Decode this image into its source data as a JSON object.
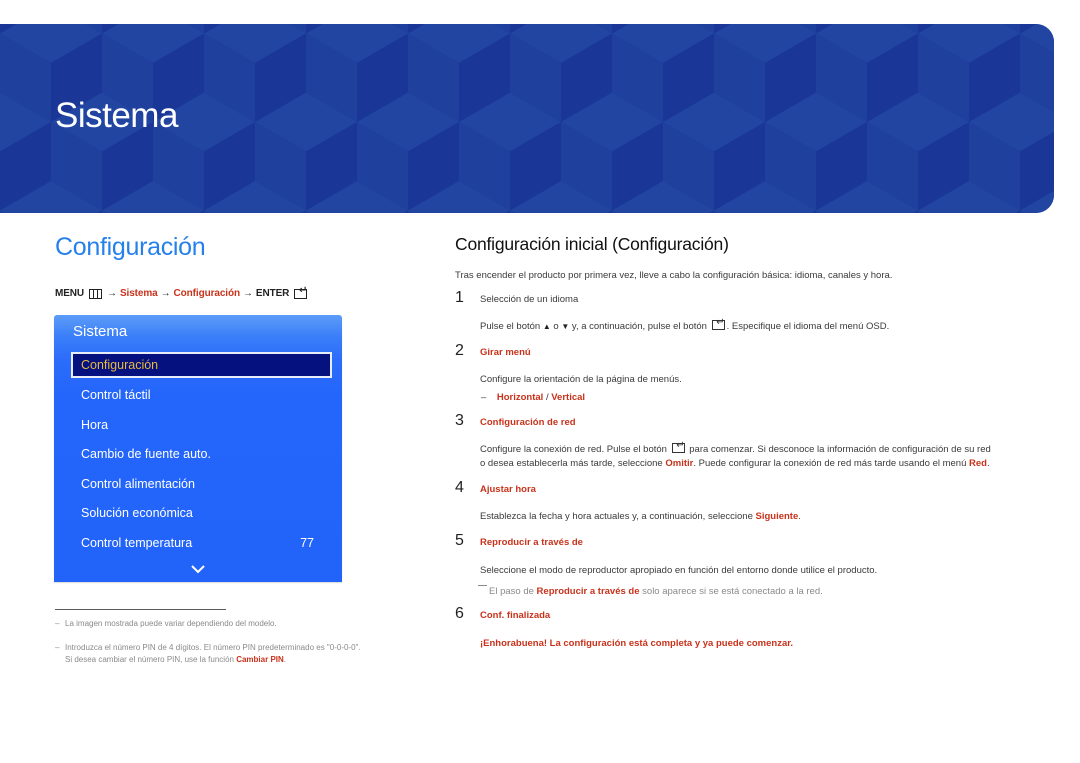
{
  "banner": {
    "title": "Sistema"
  },
  "section": {
    "title": "Configuración",
    "breadcrumb": {
      "menu": "MENU",
      "menu_icon": "menu-grid-icon",
      "arrow": "→",
      "path": [
        "Sistema",
        "Configuración"
      ],
      "enter": "ENTER",
      "enter_icon": "enter-icon"
    }
  },
  "panel": {
    "title": "Sistema",
    "items": [
      {
        "label": "Configuración",
        "selected": true
      },
      {
        "label": "Control táctil"
      },
      {
        "label": "Hora"
      },
      {
        "label": "Cambio de fuente auto."
      },
      {
        "label": "Control alimentación"
      },
      {
        "label": "Solución económica"
      },
      {
        "label": "Control temperatura",
        "value": "77"
      }
    ],
    "more_icon": "chevron-down-icon"
  },
  "footnotes": [
    {
      "text": "La imagen mostrada puede variar dependiendo del modelo."
    },
    {
      "line1": "Introduzca el número PIN de 4 dígitos. El número PIN predeterminado es \"0-0-0-0\".",
      "line2_pre": "Si desea cambiar el número PIN, use la función ",
      "line2_link": "Cambiar PIN",
      "line2_post": "."
    }
  ],
  "content": {
    "heading": "Configuración inicial (Configuración)",
    "intro": "Tras encender el producto por primera vez, lleve a cabo la configuración básica: idioma, canales y hora.",
    "steps": [
      {
        "num": "1",
        "title": "Selección de un idioma",
        "desc_pre": "Pulse el botón ",
        "up": "▲",
        "or": " o ",
        "down": "▼",
        "desc_mid": " y, a continuación, pulse el botón ",
        "desc_post": ". Especifique el idioma del menú OSD."
      },
      {
        "num": "2",
        "title": "Girar menú",
        "desc": "Configure la orientación de la página de menús.",
        "options_dash": "–",
        "option_a": "Horizontal",
        "sep": " / ",
        "option_b": "Vertical"
      },
      {
        "num": "3",
        "title": "Configuración de red",
        "desc1_pre": "Configure la conexión de red. Pulse el botón ",
        "desc1_post": " para comenzar. Si desconoce la información de configuración de su red",
        "desc2_pre": "o desea establecerla más tarde, seleccione ",
        "desc2_link1": "Omitir",
        "desc2_mid": ". Puede configurar la conexión de red más tarde usando el menú ",
        "desc2_link2": "Red",
        "desc2_post": "."
      },
      {
        "num": "4",
        "title": "Ajustar hora",
        "desc_pre": "Establezca la fecha y hora actuales y, a continuación, seleccione ",
        "desc_link": "Siguiente",
        "desc_post": "."
      },
      {
        "num": "5",
        "title": "Reproducir a través de",
        "desc": "Seleccione el modo de reproductor apropiado en función del entorno donde utilice el producto.",
        "note_pre": "El paso de ",
        "note_link": "Reproducir a través de",
        "note_post": " solo aparece si se está conectado a la red."
      },
      {
        "num": "6",
        "title": "Conf. finalizada",
        "desc": "¡Enhorabuena! La configuración está completa y ya puede comenzar."
      }
    ]
  },
  "colors": {
    "accent_blue": "#2680eb",
    "link_red": "#c8321b",
    "banner_blue": "#1d3a9a",
    "panel_blue": "#2263fa",
    "selected_bg": "#04117e",
    "selected_text": "#e7b93f"
  }
}
